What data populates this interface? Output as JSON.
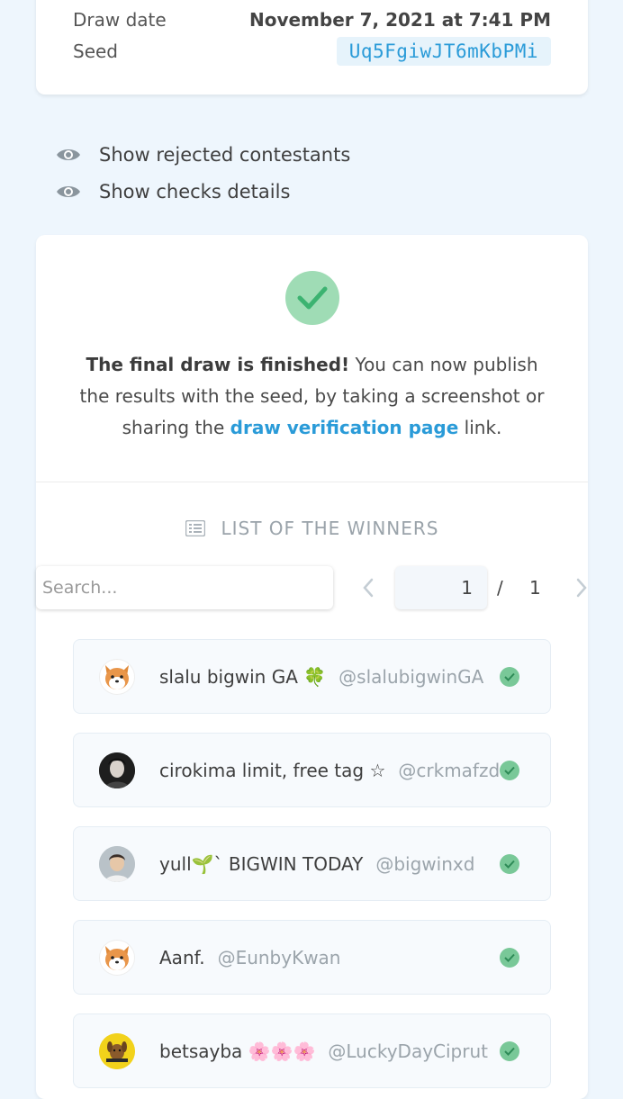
{
  "draw_info": {
    "draw_date_label": "Draw date",
    "draw_date_value": "November 7, 2021 at 7:41 PM",
    "seed_label": "Seed",
    "seed_value": "Uq5FgiwJT6mKbPMi"
  },
  "toggles": {
    "rejected": "Show rejected contestants",
    "checks": "Show checks details"
  },
  "result": {
    "bold": "The final draw is finished!",
    "text1": " You can now publish the results with the seed, by taking a screenshot or sharing the ",
    "link": "draw verification page",
    "text2": " link."
  },
  "winners": {
    "title": "LIST OF THE WINNERS",
    "search_placeholder": "Search...",
    "page_current": "1",
    "page_separator": "/",
    "page_total": "1",
    "items": [
      {
        "name": "slalu bigwin GA 🍀",
        "handle": "@slalubigwinGA"
      },
      {
        "name": "cirokima limit, free tag ☆",
        "handle": "@crkmafzd"
      },
      {
        "name": "yull🌱` BIGWIN TODAY",
        "handle": "@bigwinxd"
      },
      {
        "name": "Aanf.",
        "handle": "@EunbyKwan"
      },
      {
        "name": "betsayba 🌸🌸🌸",
        "handle": "@LuckyDayCiprut"
      }
    ]
  },
  "colors": {
    "accent": "#2a9bd8",
    "success": "#79c898",
    "background": "#eef6fd"
  }
}
